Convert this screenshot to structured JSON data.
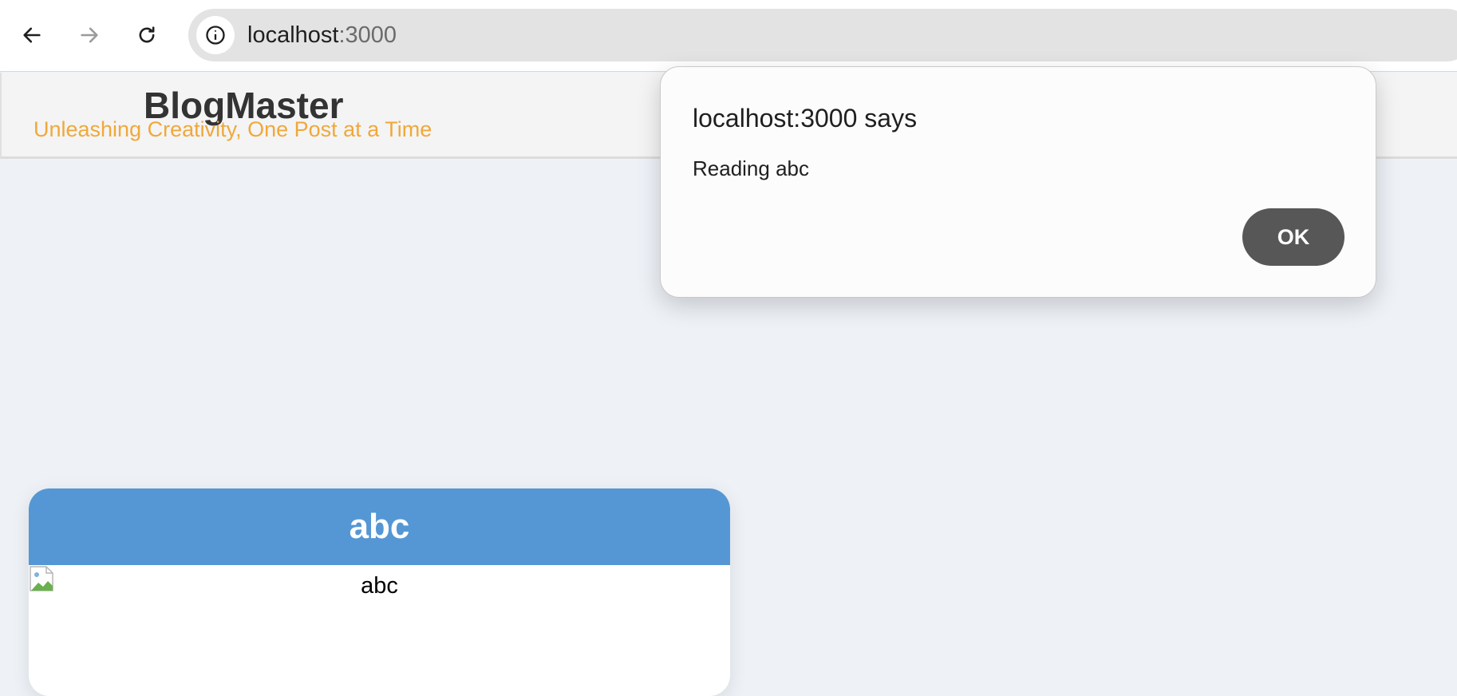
{
  "browser": {
    "url_host": "localhost",
    "url_port": ":3000",
    "back_icon": "arrow-left-icon",
    "forward_icon": "arrow-right-icon",
    "reload_icon": "reload-icon",
    "site_info_icon": "info-circle-icon"
  },
  "site": {
    "brand": "BlogMaster",
    "tagline": "Unleashing Creativity, One Post at a Time"
  },
  "post": {
    "title": "abc",
    "image_alt": "abc"
  },
  "dialog": {
    "title": "localhost:3000 says",
    "message": "Reading abc",
    "ok_label": "OK"
  },
  "colors": {
    "page_bg": "#eef2f7",
    "tagline": "#f0a83a",
    "card_header": "#5597d4",
    "ok_button": "#575757"
  }
}
